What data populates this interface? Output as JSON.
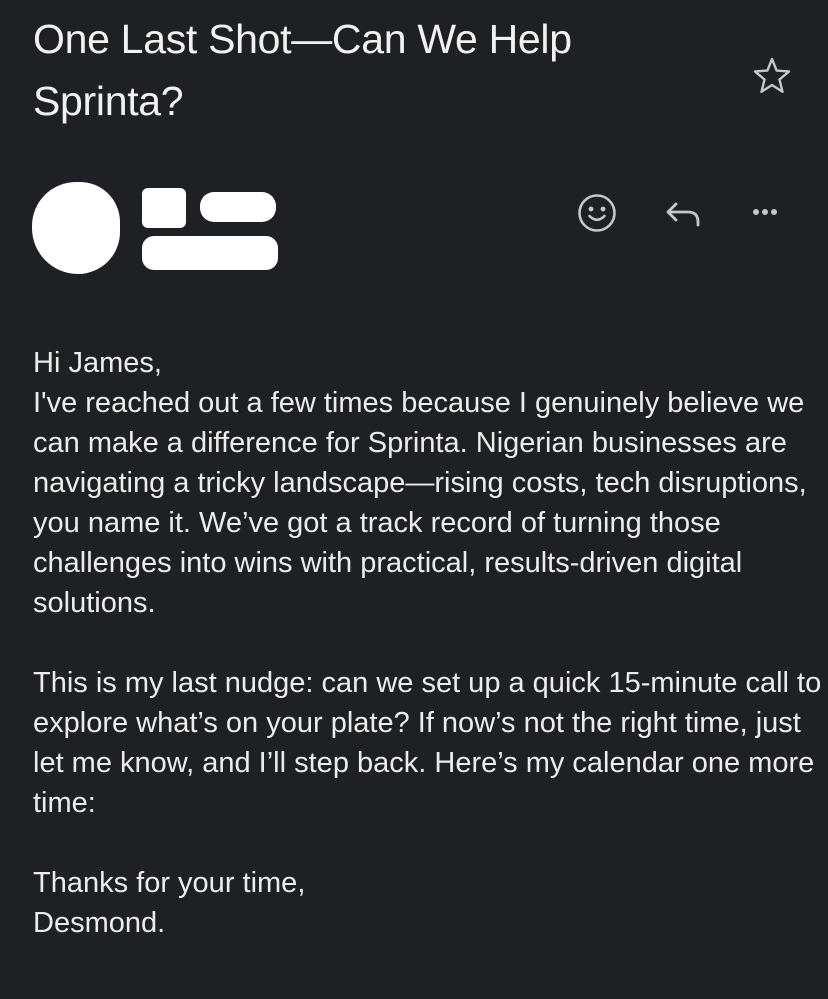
{
  "email": {
    "subject": "One Last Shot—Can We Help Sprinta?",
    "icons": {
      "star": "star-outline-icon",
      "emoji": "emoji-reaction-icon",
      "reply": "reply-icon",
      "more": "more-horizontal-icon"
    },
    "body": {
      "greeting": "Hi James,",
      "paragraph1": "I've reached out a few times because I genuinely believe we can make a difference for Sprinta. Nigerian businesses are navigating a tricky landscape—rising costs, tech disruptions, you name it. We’ve got a track record of turning those challenges into wins with practical, results-driven digital solutions.",
      "paragraph2": "This is my last nudge: can we set up a quick 15-minute call to explore what’s on your plate? If now’s not the right time, just let me know, and I’ll step back. Here’s my calendar one more time:",
      "signoff": "Thanks for your time,",
      "signature": "Desmond."
    }
  },
  "colors": {
    "background": "#1f2023",
    "text": "#ececec",
    "icon": "#c4c7cc"
  }
}
